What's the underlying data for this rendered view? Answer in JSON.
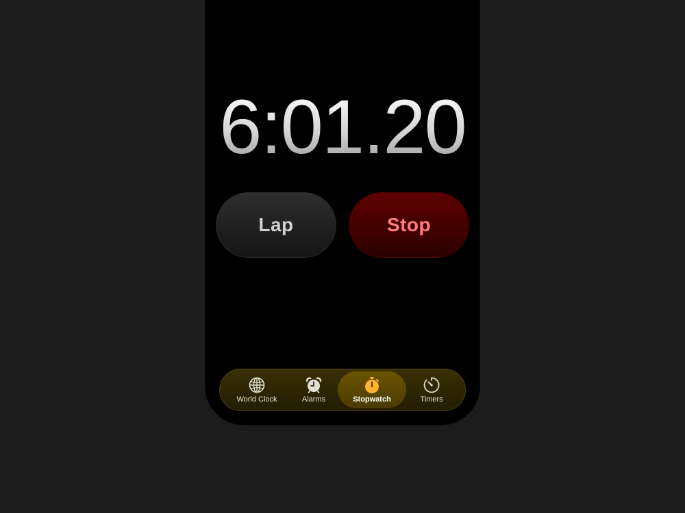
{
  "stopwatch": {
    "time": "6:01.20"
  },
  "controls": {
    "lap_label": "Lap",
    "stop_label": "Stop"
  },
  "tabs": [
    {
      "label": "World Clock",
      "icon": "globe-icon",
      "active": false
    },
    {
      "label": "Alarms",
      "icon": "alarm-clock-icon",
      "active": false
    },
    {
      "label": "Stopwatch",
      "icon": "stopwatch-icon",
      "active": true
    },
    {
      "label": "Timers",
      "icon": "timer-icon",
      "active": false
    }
  ],
  "colors": {
    "accent": "#ffb22e",
    "stop_text": "#ff7c7c",
    "stop_bg": "#4a0000",
    "lap_bg": "#232323"
  }
}
